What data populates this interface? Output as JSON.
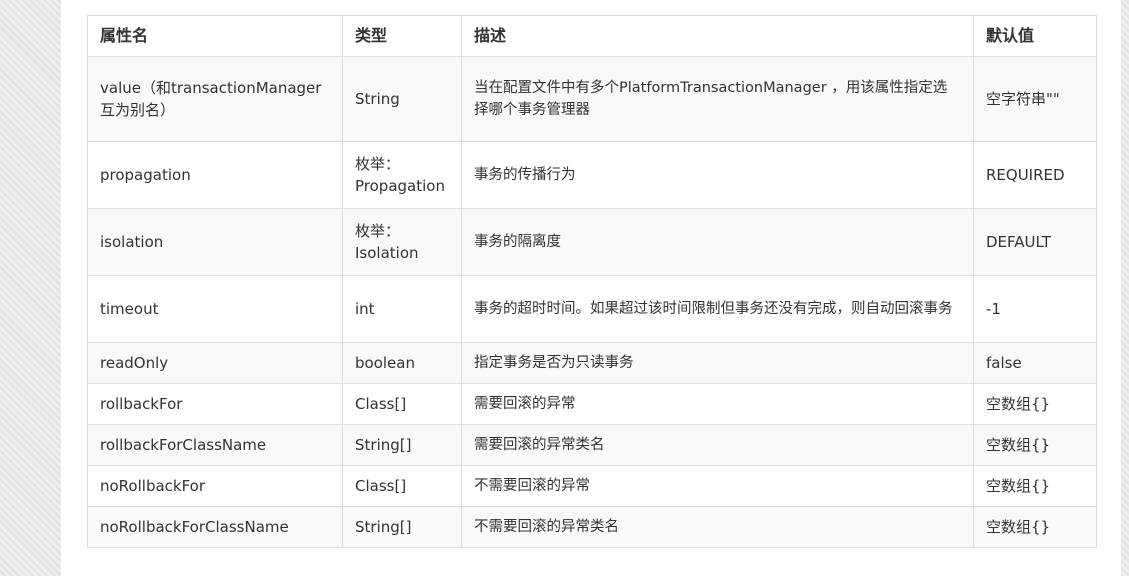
{
  "table": {
    "headers": [
      "属性名",
      "类型",
      "描述",
      "默认值"
    ],
    "rows": [
      [
        "value（和transactionManager互为别名）",
        "String",
        "当在配置文件中有多个PlatformTransactionManager ，用该属性指定选择哪个事务管理器",
        "空字符串\"\""
      ],
      [
        "propagation",
        "枚举：Propagation",
        "事务的传播行为",
        "REQUIRED"
      ],
      [
        "isolation",
        "枚举：Isolation",
        "事务的隔离度",
        "DEFAULT"
      ],
      [
        "timeout",
        "int",
        "事务的超时时间。如果超过该时间限制但事务还没有完成，则自动回滚事务",
        "-1"
      ],
      [
        "readOnly",
        "boolean",
        "指定事务是否为只读事务",
        "false"
      ],
      [
        "rollbackFor",
        "Class[]",
        "需要回滚的异常",
        "空数组{}"
      ],
      [
        "rollbackForClassName",
        "String[]",
        "需要回滚的异常类名",
        "空数组{}"
      ],
      [
        "noRollbackFor",
        "Class[]",
        "不需要回滚的异常",
        "空数组{}"
      ],
      [
        "noRollbackForClassName",
        "String[]",
        "不需要回滚的异常类名",
        "空数组{}"
      ]
    ]
  }
}
